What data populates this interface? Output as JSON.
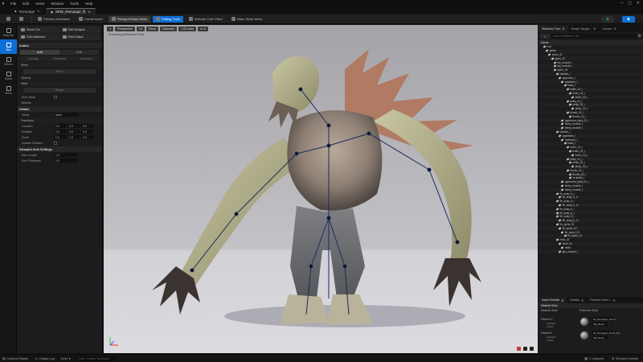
{
  "menubar": {
    "items": [
      "File",
      "Edit",
      "Asset",
      "Window",
      "Tools",
      "Help"
    ]
  },
  "tabs": [
    {
      "label": "Rampage",
      "active": false
    },
    {
      "label": "SKM_Rampage_fk",
      "active": true
    }
  ],
  "toolbar": {
    "buttons": [
      "Preview Animation",
      "Create Asset",
      "Reimport Base Mesh",
      "Editing Tools",
      "Activate Cloth Paint",
      "Make Static Mesh"
    ],
    "highlighted": "Reimport Base Mesh",
    "active": "Editing Tools"
  },
  "modes": [
    {
      "label": "Selection",
      "active": false
    },
    {
      "label": "Skin",
      "active": true
    },
    {
      "label": "Deform",
      "active": false
    },
    {
      "label": "Model",
      "active": false
    },
    {
      "label": "Mesh",
      "active": false
    }
  ],
  "tool_panel": {
    "tools": [
      "Mesh Elm",
      "Edit Weights",
      "Edit Attributes",
      "Paint Maps"
    ],
    "sections": {
      "action": "Action",
      "action_tabs": [
        "Add",
        "Edit"
      ],
      "action_modes": [
        "Topology",
        "Orientation",
        "Transform"
      ],
      "mirror": "Mirror",
      "mirror_button": "Mirror",
      "mirror_sub": "Options",
      "weld": "Weld",
      "weld_button": "Bridge",
      "weld_check": "Auto Weld",
      "details_sub": "Options",
      "details": "Details",
      "name_label": "Name",
      "name_value": "None",
      "transform": "Transform",
      "location_label": "Location",
      "rotation_label": "Rotation",
      "scale_label": "Scale",
      "update_label": "Update Children",
      "viewport_axis": "Viewport Axis Settings",
      "axis_length_label": "Axis Length",
      "axis_length_value": "1.0",
      "axis_thickness_label": "Axis Thickness",
      "axis_thickness_value": "0.0"
    },
    "location": [
      "0.0",
      "0.0",
      "0.0"
    ],
    "rotation": [
      "0.0",
      "0.0",
      "0.0"
    ],
    "scale": [
      "1.0",
      "1.0",
      "1.0"
    ]
  },
  "viewport": {
    "buttons": [
      "Perspective",
      "Lit",
      "Show",
      "Character",
      "LOD Auto",
      "x1.0"
    ],
    "sub_label": "Previewing Reference Pose"
  },
  "right_panel": {
    "tabs": [
      "Skeleton Tree",
      "Morph Target...",
      "Curves"
    ],
    "add_button": "+",
    "search_placeholder": "Search Skeleton Tree",
    "tree_header": "Name",
    "bones": [
      {
        "name": "root",
        "depth": 0
      },
      {
        "name": "pelvis",
        "depth": 1
      },
      {
        "name": "spine_01",
        "depth": 2
      },
      {
        "name": "spine_02",
        "depth": 3
      },
      {
        "name": "hip_muscle_l",
        "depth": 4
      },
      {
        "name": "hip_muscle_r",
        "depth": 4
      },
      {
        "name": "spine_03",
        "depth": 4
      },
      {
        "name": "clavicle_l",
        "depth": 5
      },
      {
        "name": "upperarm_l",
        "depth": 6
      },
      {
        "name": "lowerarm_l",
        "depth": 7
      },
      {
        "name": "hand_l",
        "depth": 8
      },
      {
        "name": "index_01_l",
        "depth": 9
      },
      {
        "name": "index_02_l",
        "depth": 10
      },
      {
        "name": "index_03_l",
        "depth": 11
      },
      {
        "name": "pinky_01_l",
        "depth": 9
      },
      {
        "name": "pinky_02_l",
        "depth": 10
      },
      {
        "name": "pinky_03_l",
        "depth": 11
      },
      {
        "name": "thumb_01_l",
        "depth": 9
      },
      {
        "name": "thumb_02_l",
        "depth": 10
      },
      {
        "name": "upperarm_twist_01_l",
        "depth": 7
      },
      {
        "name": "bicep_muscle_l",
        "depth": 7
      },
      {
        "name": "tricep_muscle_l",
        "depth": 7
      },
      {
        "name": "clavicle_r",
        "depth": 5
      },
      {
        "name": "upperarm_r",
        "depth": 6
      },
      {
        "name": "lowerarm_r",
        "depth": 7
      },
      {
        "name": "hand_r",
        "depth": 8
      },
      {
        "name": "index_01_r",
        "depth": 9
      },
      {
        "name": "index_02_r",
        "depth": 10
      },
      {
        "name": "index_03_r",
        "depth": 11
      },
      {
        "name": "pinky_01_r",
        "depth": 9
      },
      {
        "name": "pinky_02_r",
        "depth": 10
      },
      {
        "name": "pinky_03_r",
        "depth": 11
      },
      {
        "name": "thumb_01_r",
        "depth": 9
      },
      {
        "name": "thumb_02_r",
        "depth": 10
      },
      {
        "name": "sculpted_r",
        "depth": 10
      },
      {
        "name": "upperarm_twist_01_r",
        "depth": 7
      },
      {
        "name": "bicep_muscle_r",
        "depth": 7
      },
      {
        "name": "tricep_muscle_r",
        "depth": 7
      },
      {
        "name": "fin_scap_fr_r",
        "depth": 5
      },
      {
        "name": "fin_scap_fr_b",
        "depth": 6
      },
      {
        "name": "fin_scap_s_r",
        "depth": 5
      },
      {
        "name": "fin_scap_s_r2",
        "depth": 6
      },
      {
        "name": "fin_scap_b_l",
        "depth": 5
      },
      {
        "name": "fin_scap_b_r",
        "depth": 5
      },
      {
        "name": "fin_scap_fl_l",
        "depth": 5
      },
      {
        "name": "fin_scap_fl_r2",
        "depth": 6
      },
      {
        "name": "fin_spine_01",
        "depth": 5
      },
      {
        "name": "fin_spine_02",
        "depth": 6
      },
      {
        "name": "fin_spine_03",
        "depth": 7
      },
      {
        "name": "fin_spine_04",
        "depth": 8
      },
      {
        "name": "neck_01",
        "depth": 5
      },
      {
        "name": "neck_02",
        "depth": 6
      },
      {
        "name": "head",
        "depth": 7
      },
      {
        "name": "jaw_muscle_l",
        "depth": 6
      }
    ],
    "bottom_tabs": [
      "Asset Details",
      "Details",
      "Preview Scen..."
    ],
    "details": {
      "section": "Material Slots",
      "col_label": "Material Slots",
      "col_value": "Preferred Slots",
      "element0": "Element 0",
      "element1": "Element 1",
      "material0": "MI_Rampage_Armor",
      "material1": "MI_Rampage_Flesh_Inst",
      "slot_name": "Slot Name",
      "highlight": "Highlight",
      "isolate": "Isolate"
    }
  },
  "statusbar": {
    "content_drawer": "Content Drawer",
    "output_log": "Output Log",
    "cmd": "Cmd",
    "cmd_placeholder": "Enter Console Command",
    "unsaved": "1 Unsaved",
    "revision": "Revision Control"
  },
  "colors": {
    "accent": "#0f6fd6",
    "panel": "#1c1c1c",
    "background": "#151515"
  }
}
